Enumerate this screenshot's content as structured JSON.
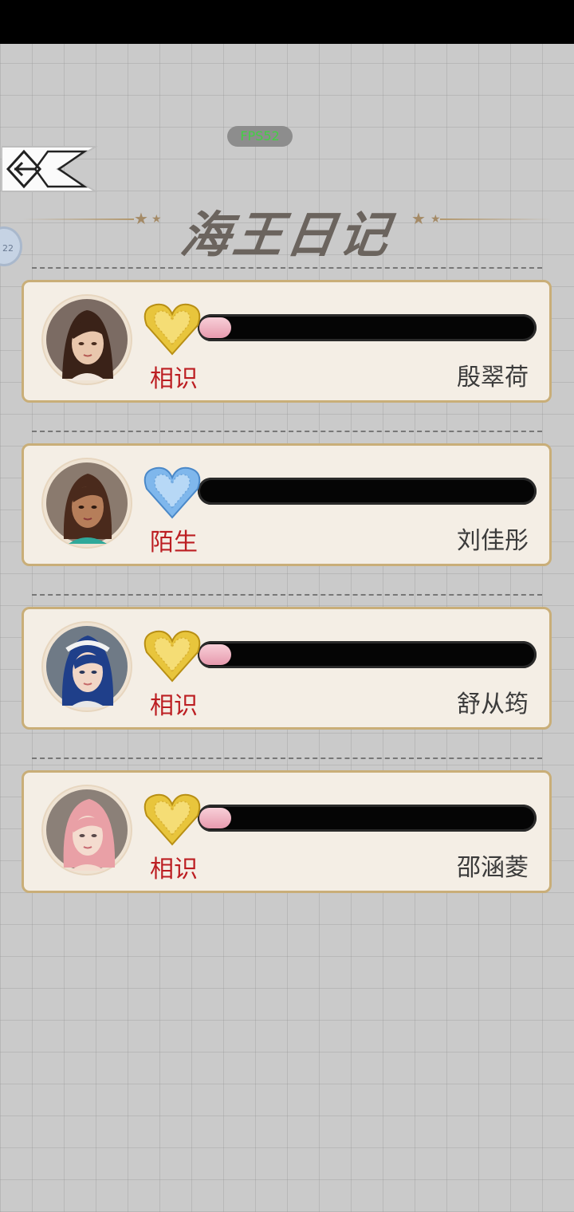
{
  "status_bar": {},
  "fps": "FPS52",
  "title": "海王日记",
  "side_bubble": "22",
  "colors": {
    "heart_gold": "#e8c53c",
    "heart_blue": "#7fb7ec",
    "status_red": "#bc1e22",
    "card_bg": "#f4eee5",
    "card_border": "#c9ae78"
  },
  "characters": [
    {
      "name": "殷翠荷",
      "relationship": "相识",
      "heart": "gold-heart-icon",
      "affinity_fraction": 0.08
    },
    {
      "name": "刘佳彤",
      "relationship": "陌生",
      "heart": "blue-heart-icon",
      "affinity_fraction": 0.0
    },
    {
      "name": "舒从筠",
      "relationship": "相识",
      "heart": "gold-heart-icon",
      "affinity_fraction": 0.05
    },
    {
      "name": "邵涵菱",
      "relationship": "相识",
      "heart": "gold-heart-icon",
      "affinity_fraction": 0.06
    }
  ]
}
